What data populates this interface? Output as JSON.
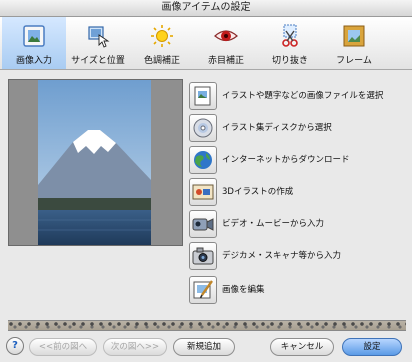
{
  "window": {
    "title": "画像アイテムの設定"
  },
  "tabs": [
    {
      "label": "画像入力",
      "icon": "image-input-icon",
      "active": true
    },
    {
      "label": "サイズと位置",
      "icon": "size-position-icon",
      "active": false
    },
    {
      "label": "色調補正",
      "icon": "color-correction-icon",
      "active": false
    },
    {
      "label": "赤目補正",
      "icon": "red-eye-icon",
      "active": false
    },
    {
      "label": "切り抜き",
      "icon": "crop-icon",
      "active": false
    },
    {
      "label": "フレーム",
      "icon": "frame-icon",
      "active": false
    }
  ],
  "actions": [
    {
      "label": "イラストや題字などの画像ファイルを選択",
      "icon": "image-file-icon"
    },
    {
      "label": "イラスト集ディスクから選択",
      "icon": "disc-icon"
    },
    {
      "label": "インターネットからダウンロード",
      "icon": "internet-download-icon"
    },
    {
      "label": "3Dイラストの作成",
      "icon": "3d-illustration-icon"
    },
    {
      "label": "ビデオ・ムービーから入力",
      "icon": "video-camera-icon"
    },
    {
      "label": "デジカメ・スキャナ等から入力",
      "icon": "digital-camera-icon"
    },
    {
      "label": "画像を編集",
      "icon": "edit-image-icon"
    }
  ],
  "footer": {
    "help": "?",
    "prev": "<<前の図へ",
    "next": "次の図へ>>",
    "new": "新規追加",
    "cancel": "キャンセル",
    "ok": "設定"
  },
  "colors": {
    "active_tab": "#a9ccf2",
    "default_button": "#5a9ae6"
  }
}
